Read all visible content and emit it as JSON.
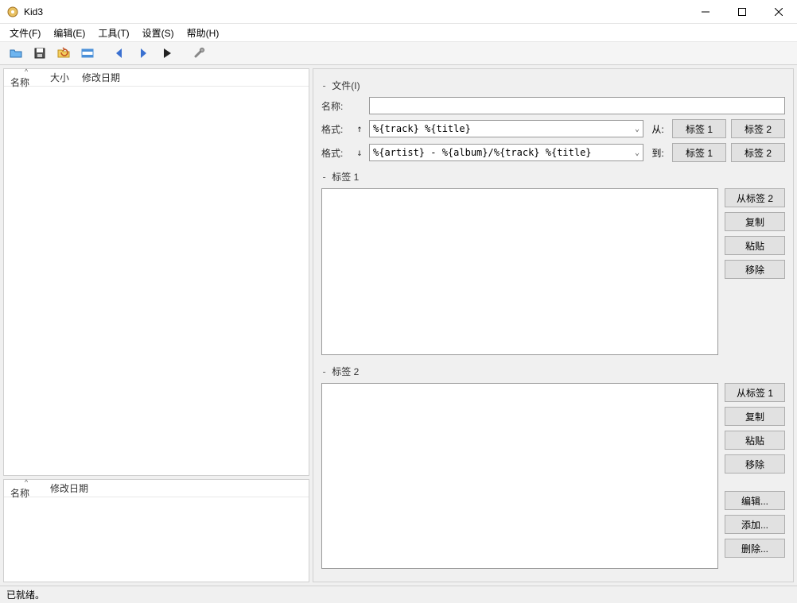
{
  "window": {
    "title": "Kid3"
  },
  "menu": {
    "file": "文件(F)",
    "edit": "编辑(E)",
    "tools": "工具(T)",
    "settings": "设置(S)",
    "help": "帮助(H)"
  },
  "filelist_top": {
    "col_name": "名称",
    "col_size": "大小",
    "col_mod": "修改日期"
  },
  "filelist_bottom": {
    "col_name": "名称",
    "col_mod": "修改日期"
  },
  "file_section": {
    "header": "文件(I)",
    "name_label": "名称:",
    "name_value": "",
    "format_up_label": "格式:",
    "format_up_value": "%{track} %{title}",
    "from_label": "从:",
    "format_down_label": "格式:",
    "format_down_value": "%{artist} - %{album}/%{track} %{title}",
    "to_label": "到:",
    "btn_tag1": "标签 1",
    "btn_tag2": "标签 2"
  },
  "tag1": {
    "header": "标签 1",
    "btn_from_tag2": "从标签 2",
    "btn_copy": "复制",
    "btn_paste": "粘贴",
    "btn_remove": "移除"
  },
  "tag2": {
    "header": "标签 2",
    "btn_from_tag1": "从标签 1",
    "btn_copy": "复制",
    "btn_paste": "粘贴",
    "btn_remove": "移除",
    "btn_edit": "编辑...",
    "btn_add": "添加...",
    "btn_delete": "删除..."
  },
  "status": {
    "text": "已就绪。"
  },
  "misc": {
    "collapse": "-",
    "arrow_up": "↑",
    "arrow_down": "↓",
    "dropdown": "⌄",
    "sort": "^"
  }
}
